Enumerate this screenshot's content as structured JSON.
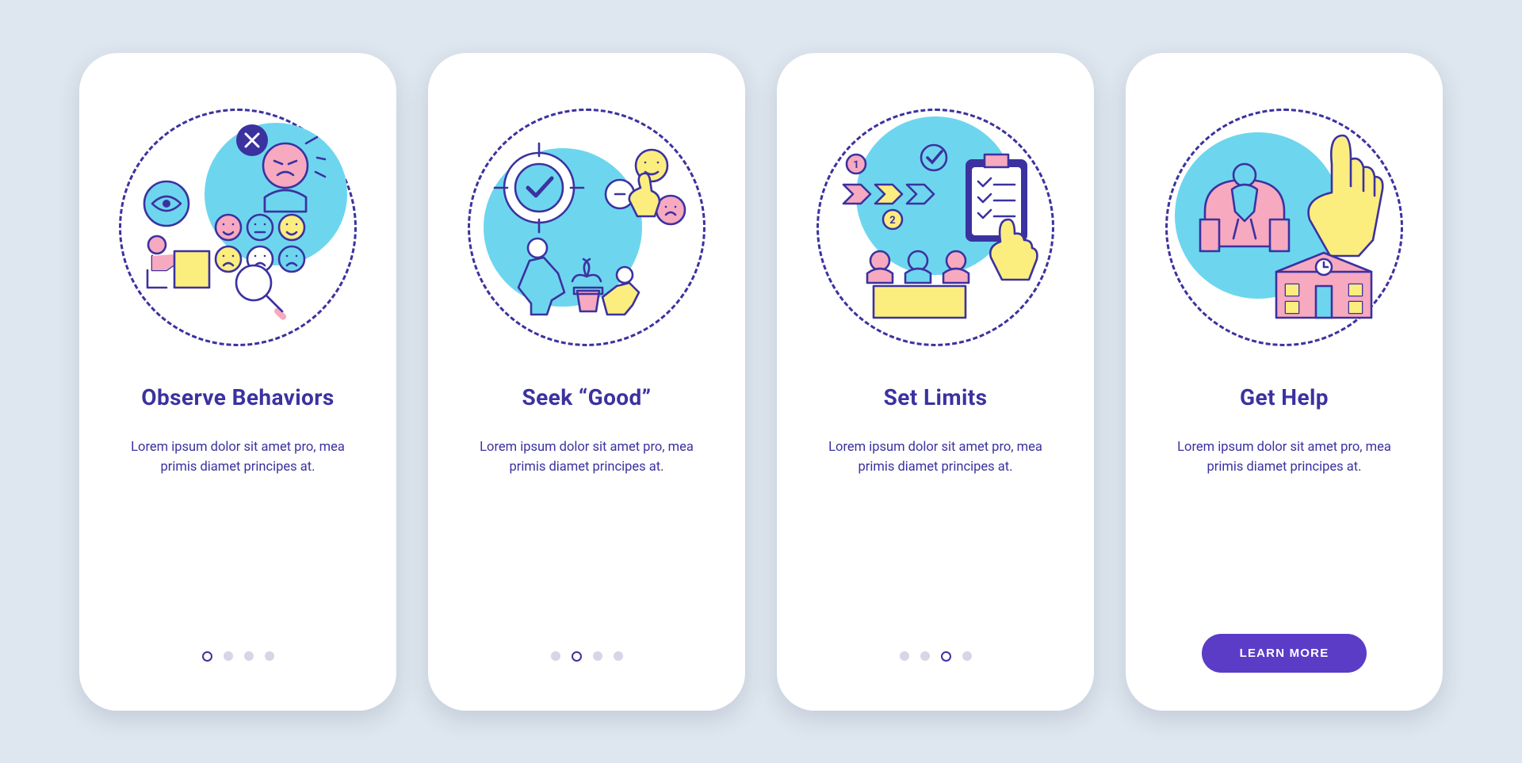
{
  "colors": {
    "accent": "#3b32a0",
    "cta_bg": "#5a3cc7",
    "light_blue": "#6dd6ee",
    "pink": "#f7a9c0",
    "yellow": "#fced7f",
    "page_bg": "#dee7ef"
  },
  "screens": [
    {
      "title": "Observe Behaviors",
      "body": "Lorem ipsum dolor sit amet pro, mea primis diamet principes at.",
      "active_dot": 0,
      "illustration": "observe"
    },
    {
      "title": "Seek “Good”",
      "body": "Lorem ipsum dolor sit amet pro, mea primis diamet principes at.",
      "active_dot": 1,
      "illustration": "seek-good"
    },
    {
      "title": "Set Limits",
      "body": "Lorem ipsum dolor sit amet pro, mea primis diamet principes at.",
      "active_dot": 2,
      "illustration": "set-limits"
    },
    {
      "title": "Get Help",
      "body": "Lorem ipsum dolor sit amet pro, mea primis diamet principes at.",
      "cta_label": "LEARN MORE",
      "illustration": "get-help"
    }
  ]
}
